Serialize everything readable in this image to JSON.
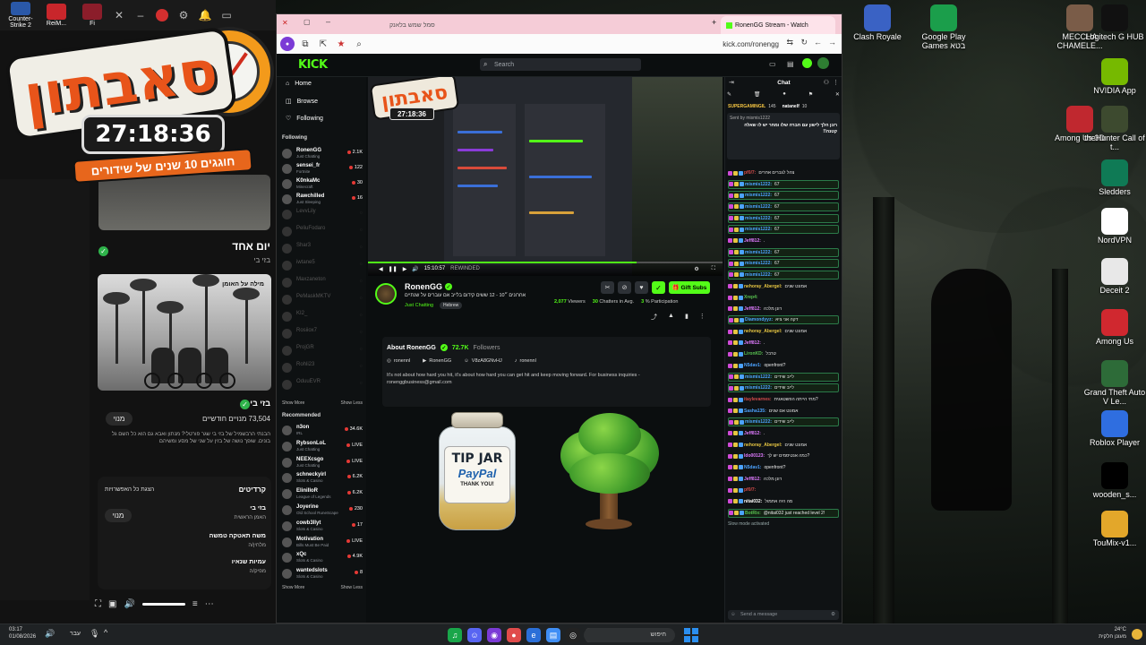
{
  "left_strip": {
    "apps": [
      "Counter-Strike 2",
      "ReiM...",
      "Fi"
    ]
  },
  "logo": {
    "title": "סאבתון",
    "timer": "27:18:36",
    "subtitle": "חוגגים 10 שנים של שידורים"
  },
  "youtube": {
    "video_title": "יום אחד",
    "video_sub": "בזי בי",
    "photo_caption": "מילה על האומן",
    "channel_name": "בזי בי",
    "subscribers": "73,504 מנויים חודשיים",
    "subscribe": "מנוי",
    "description": "הבנתי הרבשמיל של בזי בי שגר פורטלי? מנתון ואבא גם הוא כל השם גל בונים. שופך נושה של בזין על שני של מסע ומשיהם",
    "credits_heading": "קרדיטים",
    "credits_all": "הצגת כל האפשרויות",
    "credit1_name": "בזי בי",
    "credit1_role": "האמן הראשית",
    "credit2_name": "משה תאטקה טמשה",
    "credit2_role": "מלחין/ה",
    "credit3_name": "עמיות שנאיו",
    "credit3_role": "מפיק/ה"
  },
  "browser": {
    "tab_hebrew": "סמל שמש בלאנק",
    "tab_title": "RonenGG Stream - Watch",
    "url": "kick.com/ronengg"
  },
  "kick": {
    "search_placeholder": "Search",
    "nav": {
      "home": "Home",
      "browse": "Browse",
      "following": "Following"
    },
    "following_label": "Following",
    "recommended_label": "Recommended",
    "show_more": "Show More",
    "show_less": "Show Less",
    "following_channels": [
      {
        "name": "RonenGG",
        "cat": "Just Chatting",
        "viewers": "2.1K"
      },
      {
        "name": "sensei_fr",
        "cat": "Fortnite",
        "viewers": "122"
      },
      {
        "name": "K0nkaMc",
        "cat": "Minecraft",
        "viewers": "30"
      },
      {
        "name": "Rawchilled",
        "cat": "Just Sleeping",
        "viewers": "16"
      }
    ],
    "offline_channels": [
      "LevvLily",
      "PeliuFodaro",
      "Shar3",
      "iwtane5",
      "Maxzaneton",
      "PeMaskMKTV",
      "KI2_",
      "Rosiiox7",
      "ProjGR",
      "Rohli23",
      "OduuEVR"
    ],
    "recommended": [
      {
        "name": "n3on",
        "cat": "IRL",
        "viewers": "34.6K"
      },
      {
        "name": "RybsonLoL",
        "cat": "Just Chatting",
        "viewers": "LIVE"
      },
      {
        "name": "NEEXcsgo",
        "cat": "Just Chatting",
        "viewers": "LIVE"
      },
      {
        "name": "schneckyirl",
        "cat": "Slots & Casino",
        "viewers": "6.2K"
      },
      {
        "name": "EliniIIoR",
        "cat": "League of Legends",
        "viewers": "6.2K"
      },
      {
        "name": "Joyerine",
        "cat": "Old School RuneScape",
        "viewers": "230"
      },
      {
        "name": "cowb3llyt",
        "cat": "Slots & Casino",
        "viewers": "17"
      },
      {
        "name": "Motivation",
        "cat": "Bills Must Be Paid",
        "viewers": "LIVE"
      },
      {
        "name": "xQc",
        "cat": "Slots & Casino",
        "viewers": "4.9K"
      },
      {
        "name": "wantedslots",
        "cat": "Slots & Casino",
        "viewers": "8"
      }
    ],
    "video": {
      "timer": "27:18:36",
      "time": "15:10:57",
      "rewinded": "REWINDED"
    },
    "channel": {
      "name": "RonenGG",
      "title": "אחרונים ״10 - 12 ששים קידום בלייב אם עוברים על שנתיים",
      "category": "Just Chatting",
      "language": "Hebrew",
      "viewers": "2,077",
      "viewers_label": "Viewers",
      "chatters": "30",
      "chatters_label": "Chatters in Avg.",
      "participation": "3",
      "participation_label": "% Participation",
      "gift_subs": "Gift Subs"
    },
    "about": {
      "heading": "About RonenGG",
      "followers": "72.7K",
      "followers_label": "Followers",
      "socials": [
        "ronennl",
        "RonenGG",
        "V8zA8GNvHJ",
        "ronennl"
      ],
      "text": "It's not about how hard you hit, it's about how hard you can get hit and keep moving forward. For business inquiries - ronenggbusiness@gmail.com"
    },
    "tipjar": {
      "line1": "TIP JAR",
      "line2": "PayPal",
      "line3": "THANK YOU!"
    },
    "chat": {
      "heading": "Chat",
      "pinned_user": "SUPERGAMINGIL",
      "pinned_count": "145",
      "pinned_user2": "natanelf",
      "pinned_count2": "10",
      "pinned_by": "Sent by mismis1222",
      "pinned_text": "רונן הלך לישון עם חברה שלו ומחר יש לו שאלה קטנה!!",
      "input_placeholder": "Send a message",
      "slow_mode": "Slow mode activated",
      "messages": [
        {
          "user": "pf0/7:",
          "text": "צהל לגברים אחרים",
          "color": "#d34b4b",
          "hl": false
        },
        {
          "user": "mismis1222:",
          "text": "67",
          "color": "#4ca3ff",
          "hl": true
        },
        {
          "user": "mismis1222:",
          "text": "67",
          "color": "#4ca3ff",
          "hl": true
        },
        {
          "user": "mismis1222:",
          "text": "67",
          "color": "#4ca3ff",
          "hl": true
        },
        {
          "user": "mismis1222:",
          "text": "67",
          "color": "#4ca3ff",
          "hl": true
        },
        {
          "user": "mismis1222:",
          "text": "67",
          "color": "#4ca3ff",
          "hl": true
        },
        {
          "user": "Jeff812:",
          "text": ".",
          "color": "#e07bff",
          "hl": false
        },
        {
          "user": "mismis1222:",
          "text": "67",
          "color": "#4ca3ff",
          "hl": true
        },
        {
          "user": "mismis1222:",
          "text": "67",
          "color": "#4ca3ff",
          "hl": true
        },
        {
          "user": "mismis1222:",
          "text": "67",
          "color": "#4ca3ff",
          "hl": true
        },
        {
          "user": "nehoray_Abergel:",
          "text": "אמונט שנים",
          "color": "#e6c542",
          "hl": false
        },
        {
          "user": "Xrep4:",
          "text": "",
          "color": "#57c04f",
          "hl": false
        },
        {
          "user": "Jeff812:",
          "text": "רונן מלכה",
          "color": "#e07bff",
          "hl": false
        },
        {
          "user": "Diamondyyz:",
          "text": "דקה אני ציא",
          "color": "#4ca3ff",
          "hl": true
        },
        {
          "user": "nehoray_Abergel:",
          "text": "אמונט שנים",
          "color": "#e6c542",
          "hl": false
        },
        {
          "user": "Jeff812:",
          "text": ".",
          "color": "#e07bff",
          "hl": false
        },
        {
          "user": "LironKD:",
          "text": "טרבל",
          "color": "#57c04f",
          "hl": false
        },
        {
          "user": "N5dav1:",
          "text": "openfront?",
          "color": "#4ca3ff",
          "hl": false
        },
        {
          "user": "mismis1222:",
          "text": "לייב שידים",
          "color": "#4ca3ff",
          "hl": true
        },
        {
          "user": "mismis1222:",
          "text": "לייב שידים",
          "color": "#4ca3ff",
          "hl": true
        },
        {
          "user": "itaylevarnes:",
          "text": "מתי הייתה הפשטאגית?",
          "color": "#d34b4b",
          "hl": false
        },
        {
          "user": "Sasha135:",
          "text": "אמונט אם שנים",
          "color": "#4ca3ff",
          "hl": false
        },
        {
          "user": "mismis1222:",
          "text": "לייב שידים",
          "color": "#4ca3ff",
          "hl": true
        },
        {
          "user": "Jeff812:",
          "text": ".",
          "color": "#e07bff",
          "hl": false
        },
        {
          "user": "nehoray_Abergel:",
          "text": "אמונט שנים",
          "color": "#e6c542",
          "hl": false
        },
        {
          "user": "Ido00123:",
          "text": "כמה אנטיסמים יש לך?",
          "color": "#e07bff",
          "hl": false
        },
        {
          "user": "N5dav1:",
          "text": "openfront?",
          "color": "#4ca3ff",
          "hl": false
        },
        {
          "user": "Jeff812:",
          "text": "רונן מלכה",
          "color": "#e07bff",
          "hl": false
        },
        {
          "user": "pf0/7:",
          "text": "",
          "color": "#d34b4b",
          "hl": false
        },
        {
          "user": "nitai032:",
          "text": "מה היה אתמול",
          "color": "#ffffff",
          "hl": false
        },
        {
          "user": "BotRix:",
          "text": "@nitai032 just reached level 2!",
          "color": "#57c04f",
          "hl": true
        }
      ]
    }
  },
  "desktop_icons": [
    {
      "label": "Clash Royale",
      "color": "#3a62c4"
    },
    {
      "label": "Google Play Games בטא",
      "color": "#1b9e4b"
    },
    {
      "label": "MECCHA CHAMELE...",
      "color": "#7a5c48"
    },
    {
      "label": "Logitech G HUB",
      "color": "#111111"
    },
    {
      "label": "NVIDIA App",
      "color": "#76b900"
    },
    {
      "label": "Among Us 3D",
      "color": "#c0282f"
    },
    {
      "label": "theHunter Call of t...",
      "color": "#3d4a2f"
    },
    {
      "label": "Sledders",
      "color": "#0f7a55"
    },
    {
      "label": "NordVPN",
      "color": "#ffffff"
    },
    {
      "label": "Deceit 2",
      "color": "#e8e8e8"
    },
    {
      "label": "Among Us",
      "color": "#d0282f"
    },
    {
      "label": "Grand Theft Auto V Le...",
      "color": "#2d6b38"
    },
    {
      "label": "Roblox Player",
      "color": "#2f6ee0"
    },
    {
      "label": "wooden_s...",
      "color": "#000000"
    },
    {
      "label": "TouMix-v1...",
      "color": "#e3a72a"
    }
  ],
  "taskbar": {
    "time": "03:17",
    "date": "01/08/2026",
    "lang": "עבר",
    "search": "חיפוש",
    "temp": "24°C",
    "weather": "מעונן חלקית"
  }
}
